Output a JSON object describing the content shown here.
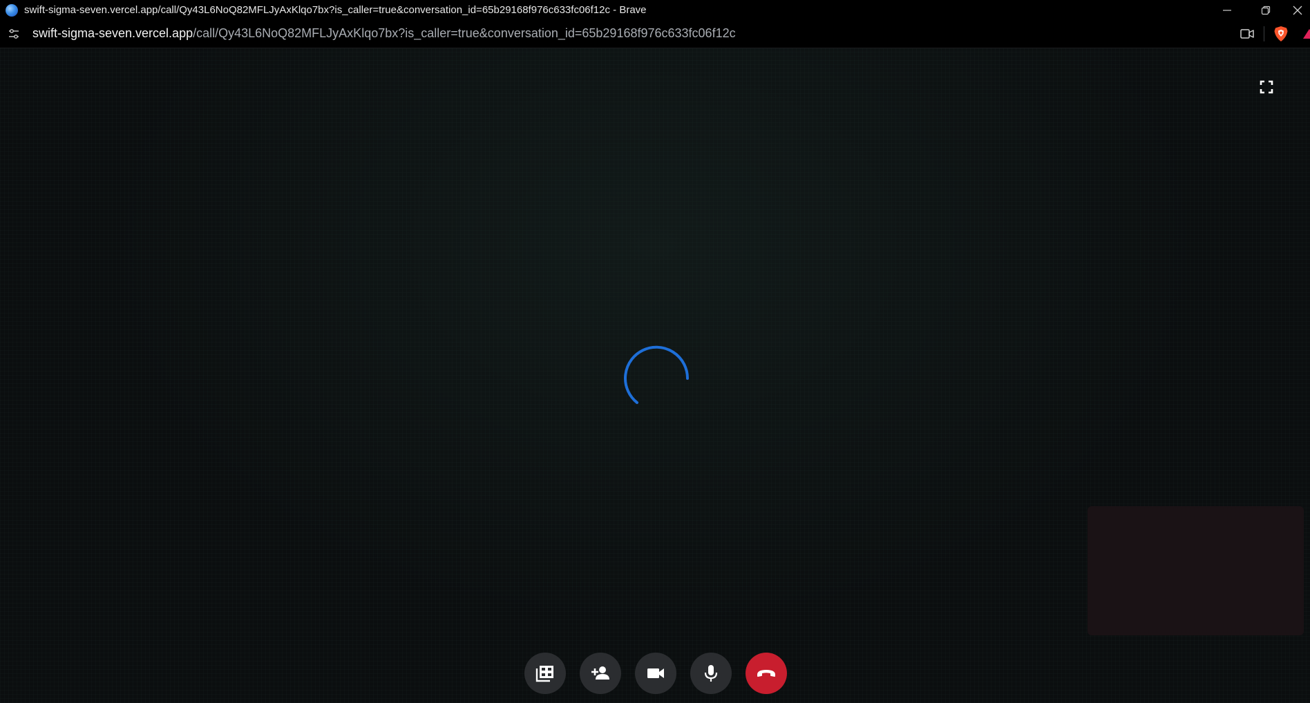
{
  "browser": {
    "window_title": "swift-sigma-seven.vercel.app/call/Qy43L6NoQ82MFLJyAxKlqo7bx?is_caller=true&conversation_id=65b29168f976c633fc06f12c - Brave",
    "url_host": "swift-sigma-seven.vercel.app",
    "url_path": "/call/Qy43L6NoQ82MFLJyAxKlqo7bx?is_caller=true&conversation_id=65b29168f976c633fc06f12c",
    "icons": {
      "favicon": "globe-favicon-icon",
      "minimize": "minimize-icon",
      "restore": "restore-icon",
      "close": "close-icon",
      "site_info": "site-settings-icon",
      "camera_permission": "camera-icon",
      "shield": "brave-shield-icon",
      "rewards": "brave-rewards-icon"
    }
  },
  "call": {
    "state": "connecting",
    "colors": {
      "spinner": "#1e6fd8",
      "end_call": "#c81e2e",
      "button_bg": "#2b2d30",
      "local_preview_bg": "#1a1215"
    },
    "controls": [
      {
        "name": "grid-layout-button",
        "icon": "grid-view-icon"
      },
      {
        "name": "add-participant-button",
        "icon": "person-add-icon"
      },
      {
        "name": "camera-toggle-button",
        "icon": "videocam-icon"
      },
      {
        "name": "microphone-toggle-button",
        "icon": "mic-icon"
      },
      {
        "name": "end-call-button",
        "icon": "call-end-icon"
      }
    ]
  }
}
